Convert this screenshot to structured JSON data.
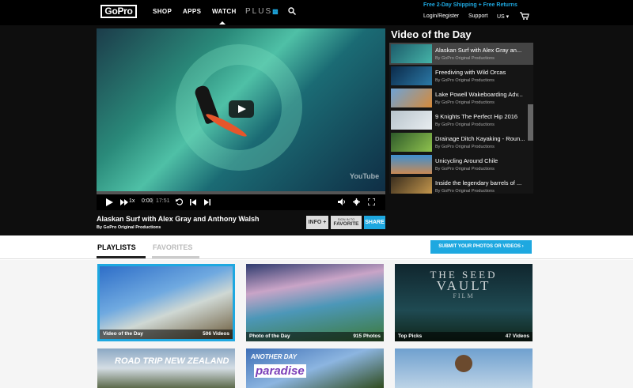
{
  "header": {
    "logo": "GoPro",
    "nav": [
      "SHOP",
      "APPS",
      "WATCH"
    ],
    "plus": "PLUS",
    "promo": "Free 2-Day Shipping + Free Returns",
    "login": "Login/Register",
    "support": "Support",
    "region": "US ▾"
  },
  "player": {
    "watermark": "YouTube",
    "speed": "1x",
    "time": "0:00",
    "duration": "17:51",
    "progress": 0.0,
    "title": "Alaskan Surf with Alex Gray and Anthony Walsh",
    "by": "By GoPro Original Productions",
    "info_label": "INFO +",
    "fav_top": "SIGN IN TO",
    "fav_label": "FAVORITE",
    "share_label": "SHARE"
  },
  "sidebar": {
    "heading": "Video of the Day",
    "items": [
      {
        "title": "Alaskan Surf with Alex Gray an...",
        "by": "By GoPro Original Productions"
      },
      {
        "title": "Freediving with Wild Orcas",
        "by": "By GoPro Original Productions"
      },
      {
        "title": "Lake Powell Wakeboarding Adv...",
        "by": "By GoPro Original Productions"
      },
      {
        "title": "9 Knights The Perfect Hip 2016",
        "by": "By GoPro Original Productions"
      },
      {
        "title": "Drainage Ditch Kayaking - Roun...",
        "by": "By GoPro Original Productions"
      },
      {
        "title": "Unicycling Around Chile",
        "by": "By GoPro Original Productions"
      },
      {
        "title": "Inside the legendary barrels of ...",
        "by": "By GoPro Original Productions"
      }
    ]
  },
  "tabs": {
    "playlists": "PLAYLISTS",
    "favorites": "FAVORITES",
    "submit": "SUBMIT YOUR PHOTOS OR VIDEOS ›"
  },
  "playlists": [
    {
      "name": "Video of the Day",
      "count": "506 Videos"
    },
    {
      "name": "Photo of the Day",
      "count": "915 Photos"
    },
    {
      "name": "Top Picks",
      "count": "47 Videos"
    }
  ],
  "overlays": {
    "seed1": "THE SEED",
    "seed2": "VAULT",
    "seed3": "FILM",
    "roadtrip": "ROAD TRIP NEW ZEALAND",
    "another": "ANOTHER DAY",
    "paradise": "paradise"
  },
  "colors": {
    "accent": "#1ea8e0",
    "bg_dark": "#0e0e0e"
  }
}
